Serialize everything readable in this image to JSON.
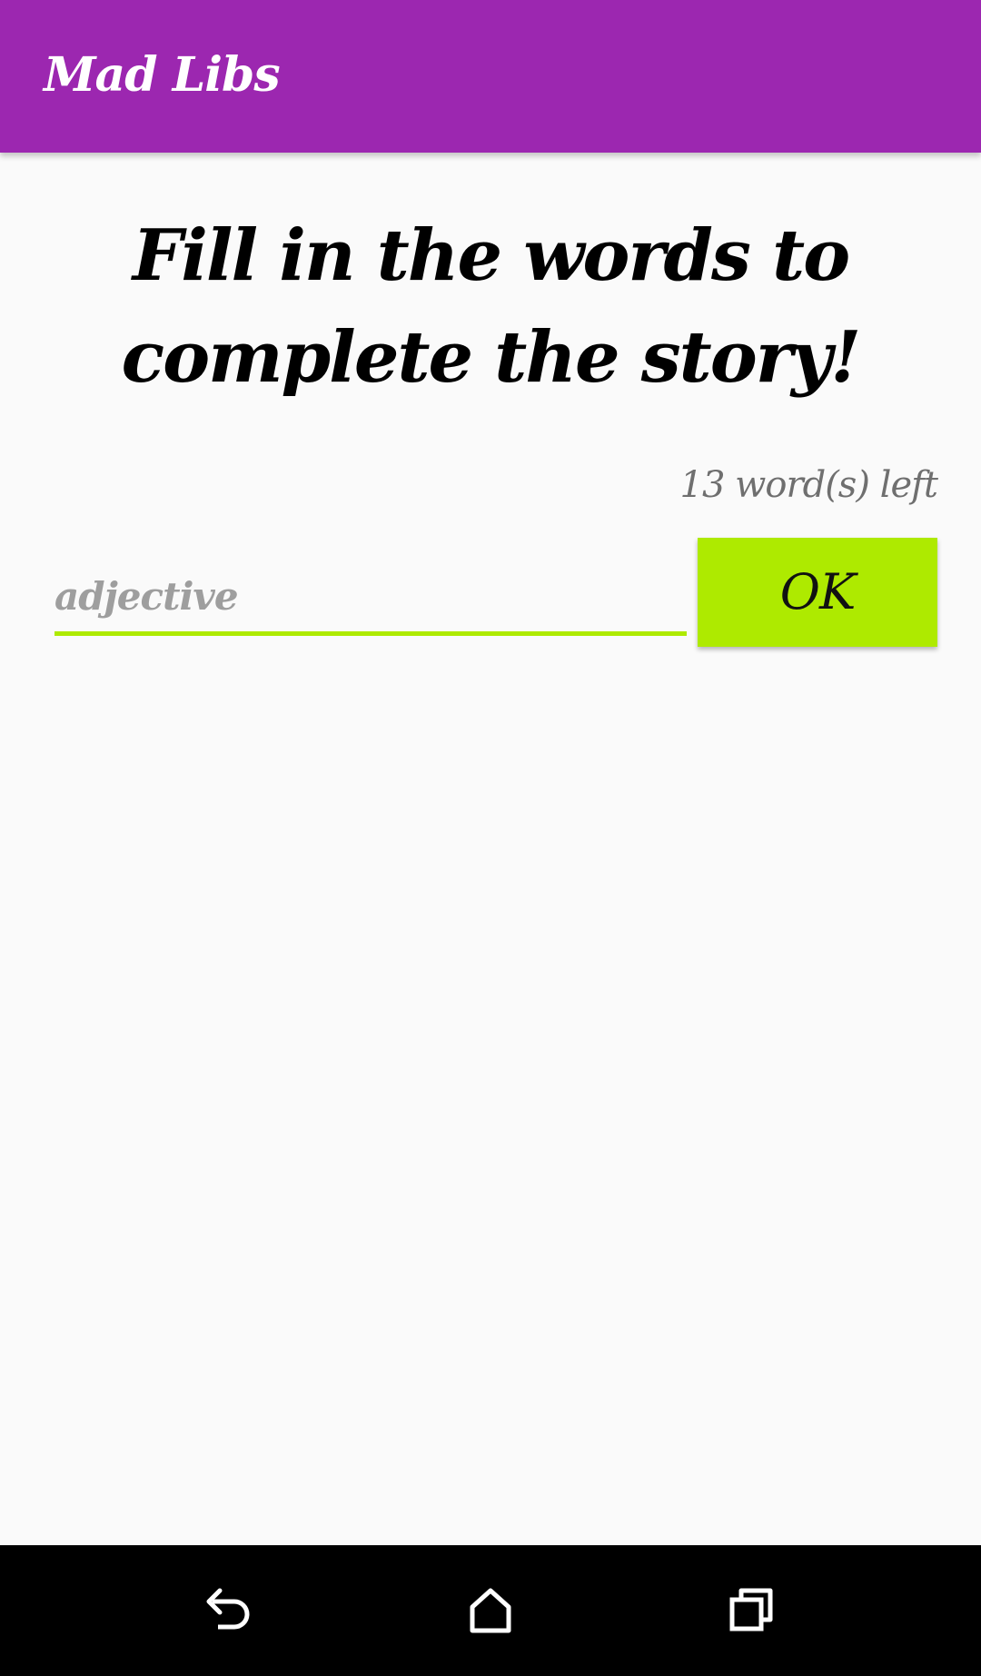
{
  "app_bar": {
    "title": "Mad Libs",
    "color": "#9c27b0"
  },
  "main": {
    "headline": "Fill in the words to complete the story!",
    "words_left": "13 word(s) left",
    "input": {
      "placeholder": "adjective",
      "value": ""
    },
    "ok_button": {
      "label": "OK",
      "color": "#aeea00"
    }
  },
  "nav_bar": {
    "buttons": [
      {
        "name": "back",
        "icon": "back-icon"
      },
      {
        "name": "home",
        "icon": "home-icon"
      },
      {
        "name": "recents",
        "icon": "recents-icon"
      }
    ]
  }
}
